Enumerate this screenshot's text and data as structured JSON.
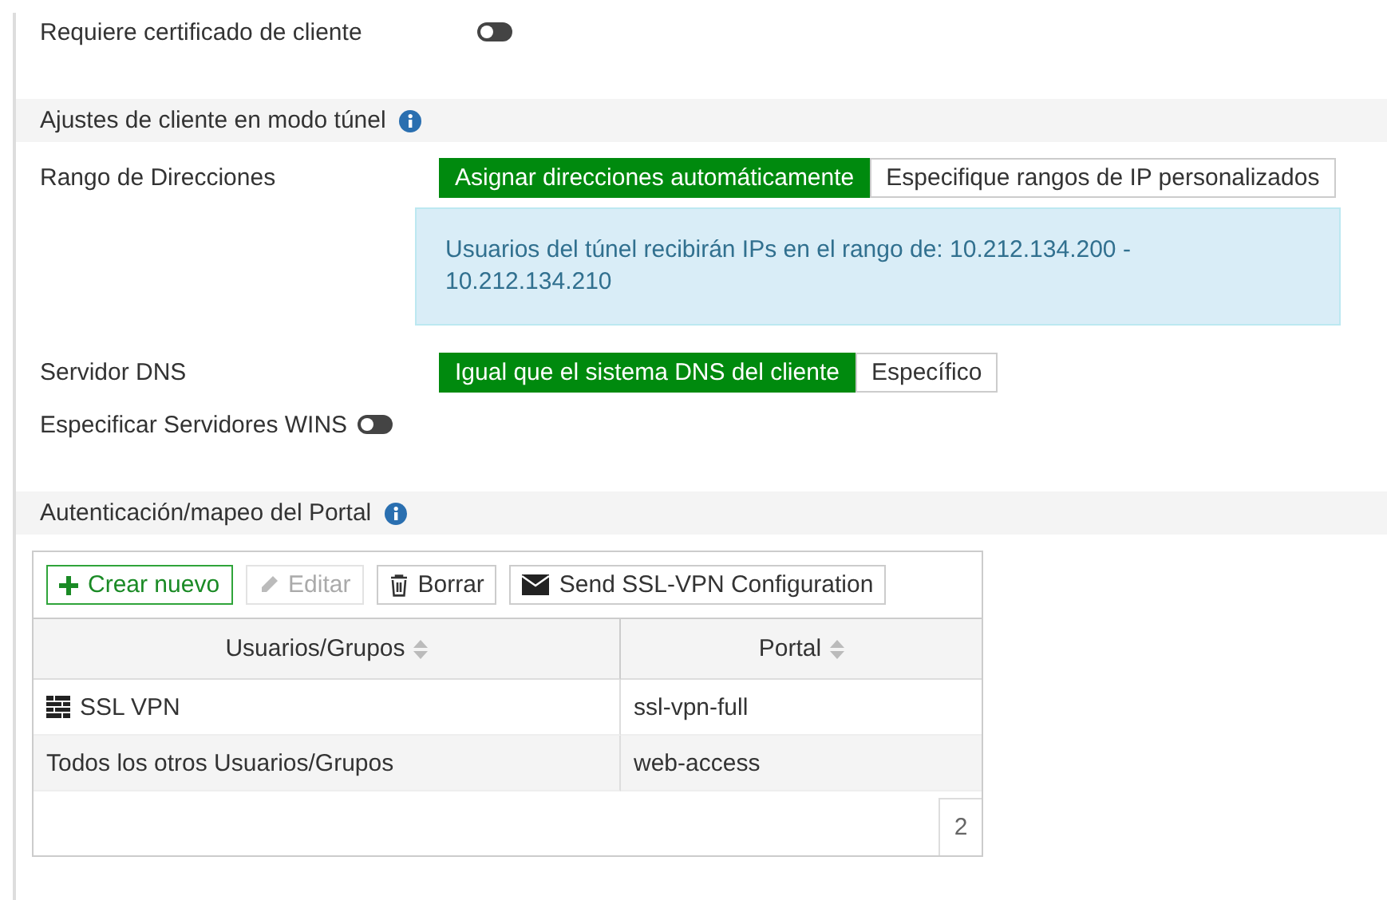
{
  "client_cert": {
    "label": "Requiere certificado de cliente",
    "on": false
  },
  "tunnel_section": {
    "title": "Ajustes de cliente en modo túnel"
  },
  "address_range": {
    "label": "Rango de Direcciones",
    "options": [
      {
        "label": "Asignar direcciones automáticamente",
        "selected": true
      },
      {
        "label": "Especifique rangos de IP personalizados",
        "selected": false
      }
    ],
    "info": "Usuarios del túnel recibirán IPs en el rango de: 10.212.134.200 - 10.212.134.210"
  },
  "dns_server": {
    "label": "Servidor DNS",
    "options": [
      {
        "label": "Igual que el sistema DNS del cliente",
        "selected": true
      },
      {
        "label": "Específico",
        "selected": false
      }
    ]
  },
  "wins": {
    "label": "Especificar Servidores WINS",
    "on": false
  },
  "portal_section": {
    "title": "Autenticación/mapeo del Portal"
  },
  "toolbar": [
    {
      "kind": "create",
      "label": "Crear nuevo",
      "disabled": false
    },
    {
      "kind": "edit",
      "label": "Editar",
      "disabled": true
    },
    {
      "kind": "delete",
      "label": "Borrar",
      "disabled": false
    },
    {
      "kind": "mail",
      "label": "Send SSL-VPN Configuration",
      "disabled": false
    }
  ],
  "table": {
    "columns": [
      "Usuarios/Grupos",
      "Portal"
    ],
    "rows": [
      {
        "group": "SSL VPN",
        "group_icon": true,
        "portal": "ssl-vpn-full"
      },
      {
        "group": "Todos los otros Usuarios/Grupos",
        "group_icon": false,
        "portal": "web-access"
      }
    ],
    "count": "2"
  }
}
